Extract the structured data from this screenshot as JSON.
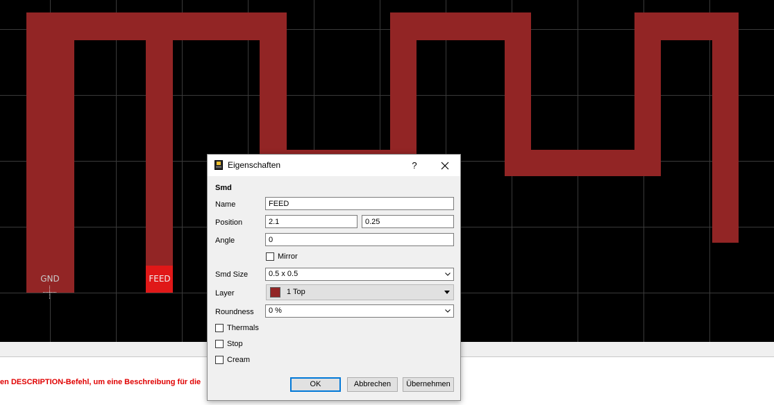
{
  "canvas": {
    "background_color": "#000000",
    "trace_color": "#922525",
    "pad_color": "#e01818",
    "pads": [
      {
        "label": "GND"
      },
      {
        "label": "FEED"
      }
    ]
  },
  "status_message": "len DESCRIPTION-Befehl, um eine Beschreibung für die",
  "dialog": {
    "title": "Eigenschaften",
    "help_label": "?",
    "close_label": "✕",
    "section": "Smd",
    "name": {
      "label": "Name",
      "value": "FEED"
    },
    "position": {
      "label": "Position",
      "x": "2.1",
      "y": "0.25"
    },
    "angle": {
      "label": "Angle",
      "value": "0"
    },
    "mirror": {
      "label": "Mirror",
      "checked": false
    },
    "smd_size": {
      "label": "Smd Size",
      "value": "0.5 x 0.5"
    },
    "layer": {
      "label": "Layer",
      "value": "1 Top",
      "color": "#922525"
    },
    "roundness": {
      "label": "Roundness",
      "value": "0 %"
    },
    "thermals": {
      "label": "Thermals",
      "checked": false
    },
    "stop": {
      "label": "Stop",
      "checked": false
    },
    "cream": {
      "label": "Cream",
      "checked": false
    },
    "buttons": {
      "ok": "OK",
      "cancel": "Abbrechen",
      "apply": "Übernehmen"
    }
  }
}
